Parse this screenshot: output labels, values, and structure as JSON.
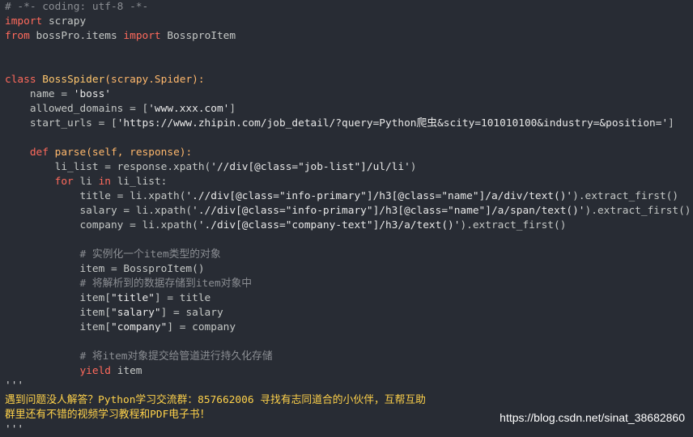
{
  "code_lines": [
    [
      {
        "t": "comment",
        "v": "# -*- coding: utf-8 -*-"
      }
    ],
    [
      {
        "t": "keyword",
        "v": "import"
      },
      {
        "t": "text",
        "v": " scrapy"
      }
    ],
    [
      {
        "t": "keyword",
        "v": "from"
      },
      {
        "t": "text",
        "v": " bossPro.items "
      },
      {
        "t": "keyword",
        "v": "import"
      },
      {
        "t": "text",
        "v": " BossproItem"
      }
    ],
    [],
    [],
    [
      {
        "t": "keyword",
        "v": "class"
      },
      {
        "t": "text",
        "v": " "
      },
      {
        "t": "class-name",
        "v": "BossSpider"
      },
      {
        "t": "base",
        "v": "(scrapy.Spider):"
      }
    ],
    [
      {
        "t": "text",
        "v": "    name = "
      },
      {
        "t": "string",
        "v": "'boss'"
      }
    ],
    [
      {
        "t": "text",
        "v": "    allowed_domains = ["
      },
      {
        "t": "string",
        "v": "'www.xxx.com'"
      },
      {
        "t": "text",
        "v": "]"
      }
    ],
    [
      {
        "t": "text",
        "v": "    start_urls = ["
      },
      {
        "t": "string",
        "v": "'https://www.zhipin.com/job_detail/?query=Python爬虫&scity=101010100&industry=&position='"
      },
      {
        "t": "text",
        "v": "]"
      }
    ],
    [],
    [
      {
        "t": "text",
        "v": "    "
      },
      {
        "t": "keyword",
        "v": "def"
      },
      {
        "t": "text",
        "v": " "
      },
      {
        "t": "def-name",
        "v": "parse"
      },
      {
        "t": "param",
        "v": "(self, response):"
      }
    ],
    [
      {
        "t": "text",
        "v": "        li_list = response.xpath("
      },
      {
        "t": "string",
        "v": "'//div[@class=\"job-list\"]/ul/li'"
      },
      {
        "t": "text",
        "v": ")"
      }
    ],
    [
      {
        "t": "text",
        "v": "        "
      },
      {
        "t": "keyword",
        "v": "for"
      },
      {
        "t": "text",
        "v": " li "
      },
      {
        "t": "keyword",
        "v": "in"
      },
      {
        "t": "text",
        "v": " li_list:"
      }
    ],
    [
      {
        "t": "text",
        "v": "            title = li.xpath("
      },
      {
        "t": "string",
        "v": "'.//div[@class=\"info-primary\"]/h3[@class=\"name\"]/a/div/text()'"
      },
      {
        "t": "text",
        "v": ").extract_first()"
      }
    ],
    [
      {
        "t": "text",
        "v": "            salary = li.xpath("
      },
      {
        "t": "string",
        "v": "'.//div[@class=\"info-primary\"]/h3[@class=\"name\"]/a/span/text()'"
      },
      {
        "t": "text",
        "v": ").extract_first()"
      }
    ],
    [
      {
        "t": "text",
        "v": "            company = li.xpath("
      },
      {
        "t": "string",
        "v": "'./div[@class=\"company-text\"]/h3/a/text()'"
      },
      {
        "t": "text",
        "v": ").extract_first()"
      }
    ],
    [],
    [
      {
        "t": "text",
        "v": "            "
      },
      {
        "t": "comment",
        "v": "# 实例化一个item类型的对象"
      }
    ],
    [
      {
        "t": "text",
        "v": "            item = BossproItem()"
      }
    ],
    [
      {
        "t": "text",
        "v": "            "
      },
      {
        "t": "comment",
        "v": "# 将解析到的数据存储到item对象中"
      }
    ],
    [
      {
        "t": "text",
        "v": "            item["
      },
      {
        "t": "string",
        "v": "\"title\""
      },
      {
        "t": "text",
        "v": "] = title"
      }
    ],
    [
      {
        "t": "text",
        "v": "            item["
      },
      {
        "t": "string",
        "v": "\"salary\""
      },
      {
        "t": "text",
        "v": "] = salary"
      }
    ],
    [
      {
        "t": "text",
        "v": "            item["
      },
      {
        "t": "string",
        "v": "\"company\""
      },
      {
        "t": "text",
        "v": "] = company"
      }
    ],
    [],
    [
      {
        "t": "text",
        "v": "            "
      },
      {
        "t": "comment",
        "v": "# 将item对象提交给管道进行持久化存储"
      }
    ],
    [
      {
        "t": "text",
        "v": "            "
      },
      {
        "t": "keyword",
        "v": "yield"
      },
      {
        "t": "text",
        "v": " item"
      }
    ],
    [
      {
        "t": "quote",
        "v": "'''"
      }
    ],
    [
      {
        "t": "footer",
        "v": "遇到问题没人解答？Python学习交流群：857662006 寻找有志同道合的小伙伴，互帮互助"
      }
    ],
    [
      {
        "t": "footer",
        "v": "群里还有不错的视频学习教程和PDF电子书！"
      }
    ],
    [
      {
        "t": "quote",
        "v": "'''"
      }
    ]
  ],
  "watermark": "https://blog.csdn.net/sinat_38682860",
  "colors": {
    "background": "#282c34",
    "keyword": "#ff6a5c",
    "class_name": "#ffc66d",
    "string": "#e8e8e8",
    "comment": "#8b8e93",
    "footer": "#ffd24a"
  }
}
